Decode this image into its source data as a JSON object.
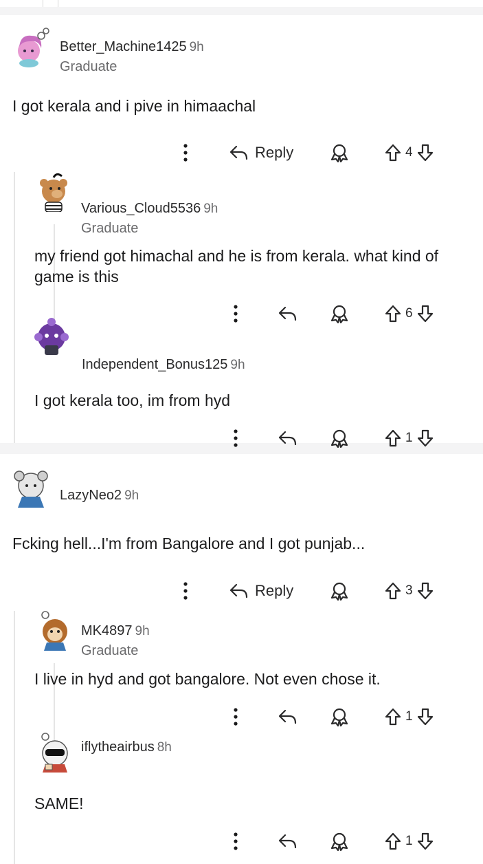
{
  "thread1": {
    "comment": {
      "user": "Better_Machine1425",
      "time": "9h",
      "flair": "Graduate",
      "body": "I got kerala and i pive in himaachal",
      "reply_label": "Reply",
      "score": "4"
    },
    "replies": [
      {
        "user": "Various_Cloud5536",
        "time": "9h",
        "flair": "Graduate",
        "body": "my friend got himachal and he is from kerala. what kind of game is this",
        "score": "6"
      },
      {
        "user": "Independent_Bonus125",
        "time": "9h",
        "body": "I got kerala too, im from hyd",
        "score": "1"
      }
    ]
  },
  "thread2": {
    "comment": {
      "user": "LazyNeo2",
      "time": "9h",
      "body": "Fcking hell...I'm from Bangalore and I got punjab...",
      "reply_label": "Reply",
      "score": "3"
    },
    "replies": [
      {
        "user": "MK4897",
        "time": "9h",
        "flair": "Graduate",
        "body": "I live in hyd and got bangalore. Not even chose it.",
        "score": "1"
      },
      {
        "user": "iflytheairbus",
        "time": "8h",
        "body": "SAME!",
        "score": "1"
      }
    ]
  },
  "icons": {
    "more": "more-vertical-icon",
    "reply": "reply-arrow-icon",
    "award": "award-icon",
    "upvote": "upvote-arrow-icon",
    "downvote": "downvote-arrow-icon"
  },
  "colors": {
    "background": "#f4f4f5",
    "card": "#ffffff",
    "thread_line": "#e5e5e5",
    "text": "#1c1c1d",
    "muted": "#6a6a6c"
  }
}
